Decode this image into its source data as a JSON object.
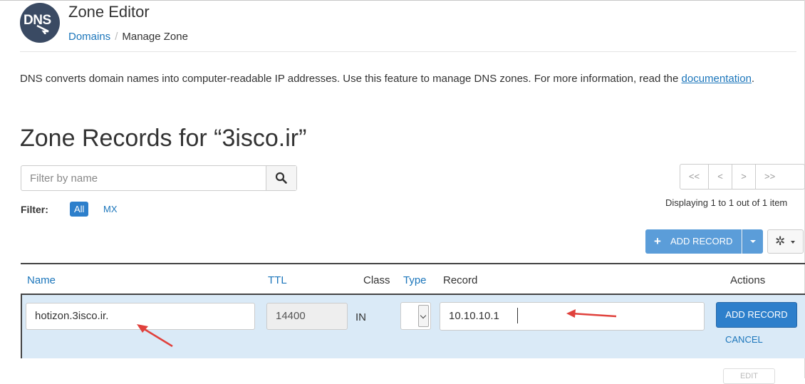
{
  "header": {
    "logo_text": "DNS",
    "title": "Zone Editor",
    "breadcrumb": {
      "link": "Domains",
      "separator": "/",
      "current": "Manage Zone"
    }
  },
  "description": {
    "text": "DNS converts domain names into computer-readable IP addresses. Use this feature to manage DNS zones. For more information, read the",
    "link": "documentation",
    "suffix": "."
  },
  "zone_title": "Zone Records for “3isco.ir”",
  "search": {
    "placeholder": "Filter by name",
    "icon": "search-icon"
  },
  "filter": {
    "label": "Filter:",
    "options": [
      "All",
      "MX"
    ],
    "active": "All"
  },
  "pagination": {
    "buttons": [
      "<<",
      "<",
      ">",
      ">>"
    ],
    "status": "Displaying 1 to 1 out of 1 item"
  },
  "toolbar": {
    "add_record_label": "ADD RECORD",
    "add_icon": "plus-icon",
    "settings_icon": "gear-icon"
  },
  "table": {
    "headers": {
      "name": "Name",
      "ttl": "TTL",
      "class": "Class",
      "type": "Type",
      "record": "Record",
      "actions": "Actions"
    }
  },
  "edit_row": {
    "name_value": "hotizon.3isco.ir.",
    "ttl_value": "14400",
    "class_value": "IN",
    "type_value": "",
    "record_value": "10.10.10.1",
    "submit_label": "ADD RECORD",
    "cancel_label": "CANCEL"
  },
  "ghost_action": "EDIT",
  "colors": {
    "accent": "#2d7fcb",
    "link": "#1c76bb",
    "row_highlight": "#daeaf7",
    "annotation_arrow": "#e0413c"
  }
}
